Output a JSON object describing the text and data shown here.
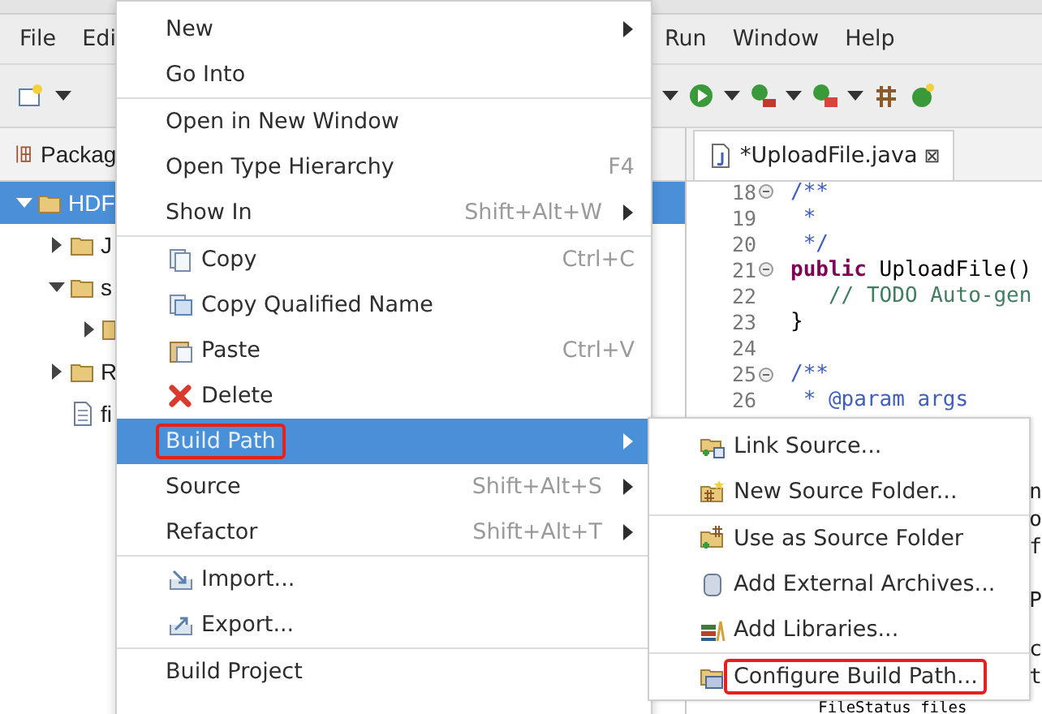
{
  "menubar": [
    "File",
    "Edi",
    "Run",
    "Window",
    "Help"
  ],
  "package_explorer": {
    "tab": "Packag",
    "tree": [
      {
        "label": "HDF",
        "selected": true,
        "expanded": true,
        "children": [
          {
            "label": "J",
            "selected": false,
            "expanded": false
          },
          {
            "label": "s",
            "selected": false,
            "expanded": true,
            "children": [
              {
                "selected": false,
                "expanded": false
              }
            ]
          },
          {
            "label": "R",
            "selected": false,
            "expanded": false
          },
          {
            "label": "fi",
            "selected": false
          }
        ]
      }
    ]
  },
  "editor": {
    "tab": {
      "label": "*UploadFile.java",
      "close": "⊠"
    },
    "lines": [
      {
        "number": "18",
        "folding": true,
        "text": "/**",
        "kind": "doc"
      },
      {
        "number": "19",
        "folding": false,
        "text": " *",
        "kind": "doc"
      },
      {
        "number": "20",
        "folding": false,
        "text": " */",
        "kind": "doc"
      },
      {
        "number": "21",
        "folding": true,
        "keyword": "public",
        "text": " UploadFile()",
        "kind": "code"
      },
      {
        "number": "22",
        "folding": false,
        "text": "   // TODO Auto-gen",
        "kind": "comment"
      },
      {
        "number": "23",
        "folding": false,
        "text": "}",
        "kind": "code"
      },
      {
        "number": "24",
        "folding": false
      },
      {
        "number": "25",
        "folding": true,
        "text": "/**",
        "kind": "doc"
      },
      {
        "number": "26",
        "folding": false,
        "text": " * @param args",
        "kind": "doc"
      },
      {
        "edge": "n"
      },
      {
        "edge": "o"
      },
      {
        "edge": "f"
      },
      {
        "edge": "P"
      },
      {
        "edge": "c"
      },
      {
        "edge": "t"
      },
      {
        "text": "   FileStatus files",
        "kind": "code"
      }
    ]
  },
  "context_menu": [
    {
      "kind": "item",
      "label": "New",
      "submenu": true,
      "selected": false,
      "annotated": false
    },
    {
      "kind": "item",
      "label": "Go Into",
      "submenu": false,
      "selected": false,
      "annotated": false
    },
    {
      "kind": "separator"
    },
    {
      "kind": "item",
      "label": "Open in New Window",
      "submenu": false,
      "selected": false,
      "annotated": false
    },
    {
      "kind": "item",
      "label": "Open Type Hierarchy",
      "shortcut": "F4",
      "submenu": false,
      "selected": false,
      "annotated": false
    },
    {
      "kind": "item",
      "label": "Show In",
      "shortcut": "Shift+Alt+W",
      "submenu": true,
      "selected": false,
      "annotated": false
    },
    {
      "kind": "separator"
    },
    {
      "kind": "icon-item",
      "label": "Copy",
      "shortcut": "Ctrl+C",
      "submenu": false,
      "selected": false,
      "annotated": false
    },
    {
      "kind": "icon-item",
      "label": "Copy Qualified Name",
      "submenu": false,
      "selected": false,
      "annotated": false
    },
    {
      "kind": "icon-item",
      "label": "Paste",
      "shortcut": "Ctrl+V",
      "submenu": false,
      "selected": false,
      "annotated": false
    },
    {
      "kind": "icon-item",
      "label": "Delete",
      "submenu": false,
      "selected": false,
      "annotated": false
    },
    {
      "kind": "item",
      "label": "Build Path",
      "submenu": true,
      "selected": true,
      "annotated": true
    },
    {
      "kind": "item",
      "label": "Source",
      "shortcut": "Shift+Alt+S",
      "submenu": true,
      "selected": false,
      "annotated": false
    },
    {
      "kind": "item",
      "label": "Refactor",
      "shortcut": "Shift+Alt+T",
      "submenu": true,
      "selected": false,
      "annotated": false
    },
    {
      "kind": "separator"
    },
    {
      "kind": "icon-item",
      "label": "Import...",
      "submenu": false,
      "selected": false,
      "annotated": false
    },
    {
      "kind": "icon-item",
      "label": "Export...",
      "submenu": false,
      "selected": false,
      "annotated": false
    },
    {
      "kind": "separator"
    },
    {
      "kind": "item",
      "label": "Build Project",
      "submenu": false,
      "selected": false,
      "annotated": false
    }
  ],
  "build_path_submenu": [
    {
      "kind": "item",
      "label": "Link Source...",
      "selected": false,
      "annotated": false
    },
    {
      "kind": "item",
      "label": "New Source Folder...",
      "selected": false,
      "annotated": false
    },
    {
      "kind": "separator"
    },
    {
      "kind": "item",
      "label": "Use as Source Folder",
      "selected": false,
      "annotated": false
    },
    {
      "kind": "item",
      "label": "Add External Archives...",
      "selected": false,
      "annotated": false
    },
    {
      "kind": "item",
      "label": "Add Libraries...",
      "selected": false,
      "annotated": false
    },
    {
      "kind": "separator"
    },
    {
      "kind": "item",
      "label": "Configure Build Path...",
      "selected": false,
      "annotated": true
    }
  ]
}
